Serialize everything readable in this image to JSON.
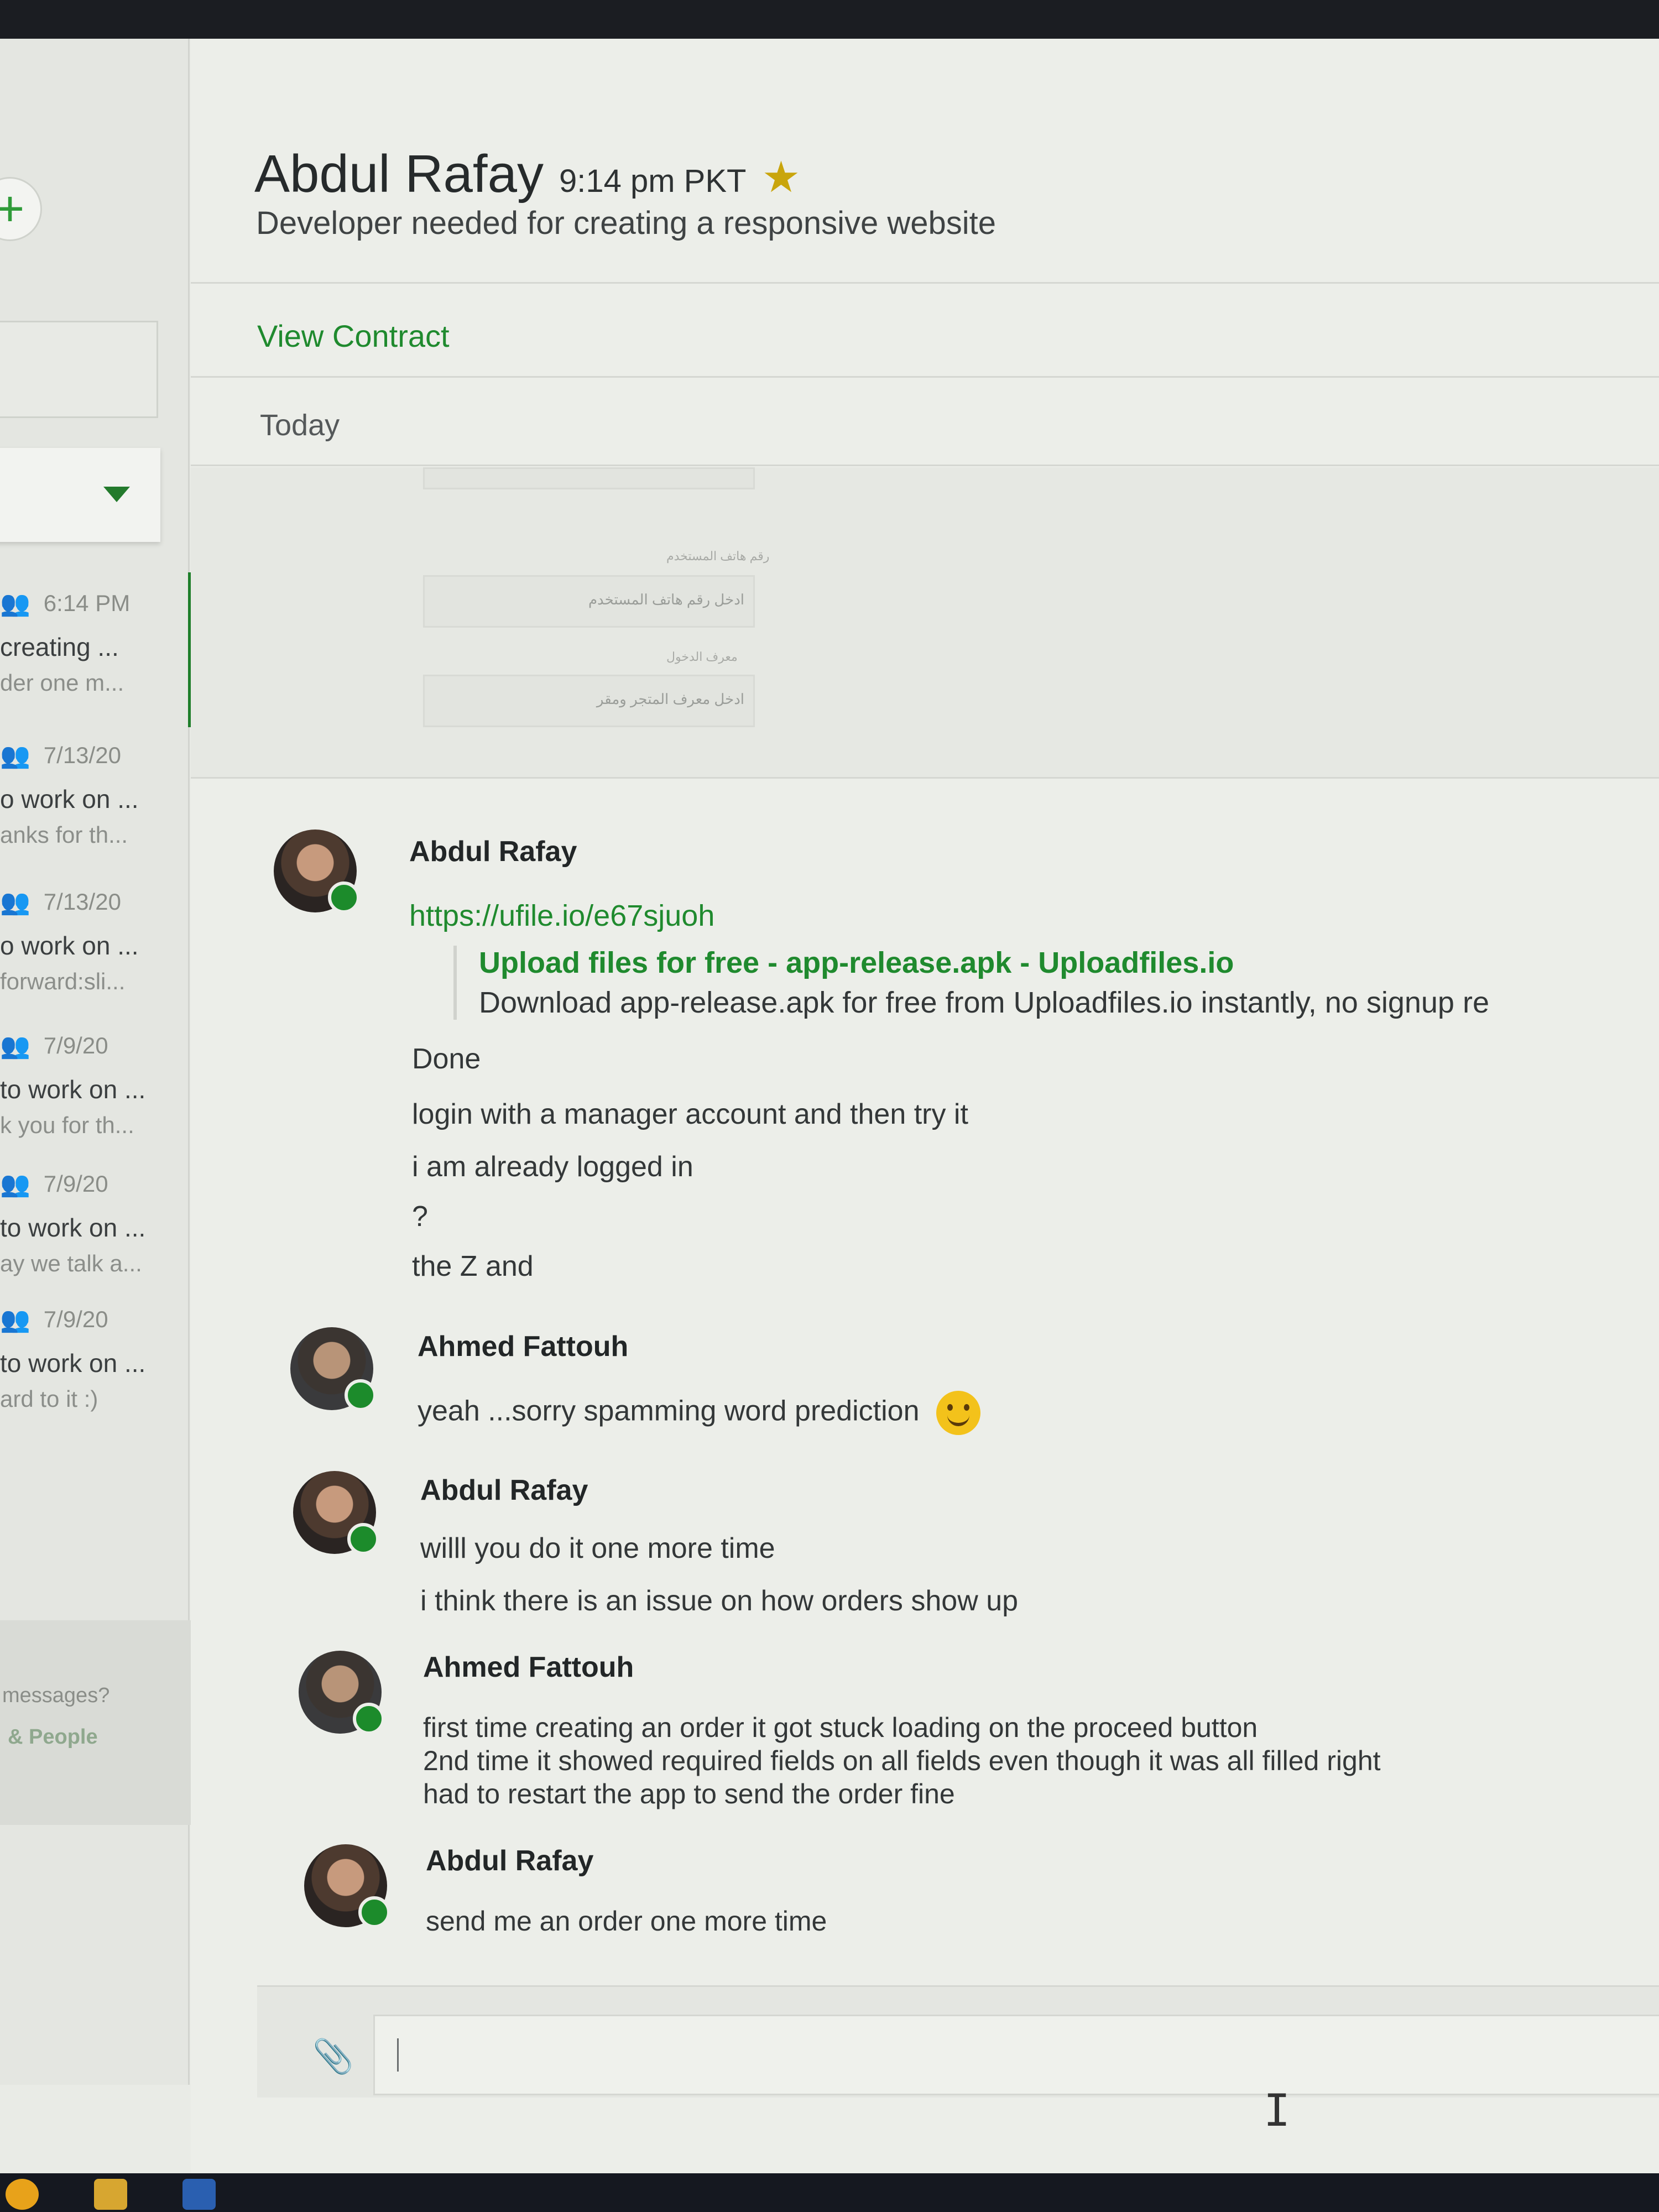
{
  "header": {
    "name": "Abdul Rafay",
    "local_time": "9:14 pm PKT",
    "star_icon": "star-icon",
    "subtitle": "Developer needed for creating a responsive website",
    "view_contract": "View Contract",
    "date_divider": "Today"
  },
  "sidebar": {
    "new_button": "+",
    "rooms": [
      {
        "time": "6:14 PM",
        "line1": "creating ...",
        "line2": "der one m..."
      },
      {
        "time": "7/13/20",
        "line1": "o work on ...",
        "line2": "anks for th..."
      },
      {
        "time": "7/13/20",
        "line1": "o work on ...",
        "line2": "forward:sli..."
      },
      {
        "time": "7/9/20",
        "line1": "to work on ...",
        "line2": "k you for th..."
      },
      {
        "time": "7/9/20",
        "line1": "to work on ...",
        "line2": "ay we talk a..."
      },
      {
        "time": "7/9/20",
        "line1": "to work on ...",
        "line2": "ard to it :)"
      }
    ],
    "footer_question": "messages?",
    "footer_link": "& People"
  },
  "form_preview": {
    "field1_label": "رقم هاتف المستخدم",
    "field1_placeholder": "ادخل رقم هاتف المستخدم",
    "field2_label": "معرف الدخول",
    "field2_placeholder": "ادخل معرف المتجر ومقر"
  },
  "messages": [
    {
      "author": "Abdul Rafay",
      "lines": [
        "https://ufile.io/e67sjuoh"
      ],
      "preview_title": "Upload files for free - app-release.apk - Uploadfiles.io",
      "preview_desc": "Download app-release.apk for free from Uploadfiles.io instantly, no signup re",
      "more": [
        "Done",
        "login with a manager account and then try it",
        "i am already logged in",
        "?",
        "the Z and"
      ]
    },
    {
      "author": "Ahmed Fattouh",
      "lines": [
        "yeah ...sorry spamming word prediction"
      ]
    },
    {
      "author": "Abdul Rafay",
      "lines": [
        "willl you do it one more time",
        "i think there is an issue on how orders show up"
      ]
    },
    {
      "author": "Ahmed Fattouh",
      "lines": [
        "first time creating an order it got stuck loading on the proceed button",
        "2nd time it showed required fields on all fields even though it was all filled right",
        "had to restart the app to send the order fine"
      ]
    },
    {
      "author": "Abdul Rafay",
      "lines": [
        "send me an order one more time"
      ]
    }
  ],
  "composer": {
    "attach_icon": "paperclip-icon",
    "value": ""
  },
  "colors": {
    "accent": "#1f8a2e",
    "status_online": "#1c8b2b",
    "star": "#c9a50c"
  }
}
